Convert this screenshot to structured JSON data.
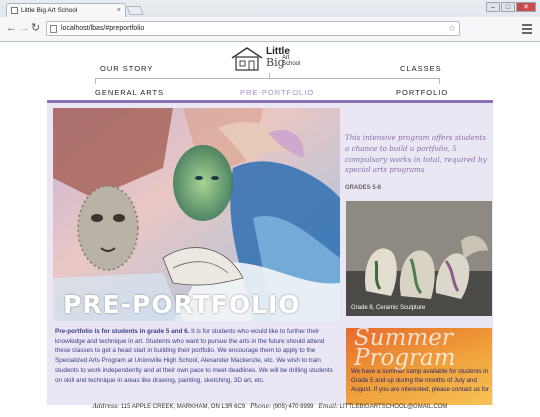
{
  "browser": {
    "tab_title": "Little Big Art School",
    "tab_close": "×",
    "url": "localhost/lbas/#preportfolio",
    "controls": {
      "minimize": "–",
      "maximize": "□",
      "close": "✕"
    },
    "back": "←",
    "forward": "→",
    "reload": "↻"
  },
  "logo": {
    "line1": "Little",
    "line2": "Big",
    "line3a": "Art",
    "line3b": "School"
  },
  "nav": {
    "our_story": "OUR STORY",
    "classes": "CLASSES",
    "general_arts": "GENERAL ARTS",
    "pre_portfolio": "PRE-PORTFOLIO",
    "portfolio": "PORTFOLIO"
  },
  "hero_title": "PRE-PORTFOLIO",
  "intro": "This intensive program offers students a chance to build a portfolio, 5 compulsory works in total, required by special arts programs",
  "grades": "GRADES 5-8",
  "sculpture_caption": "Grade 8, Ceramic Sculpture",
  "description_lead": "Pre-portfolio is for students in grade 5 and 6.",
  "description_body": " It is for students who would like to further their knowledge and technique in art. Students who want to pursue the arts in the future should attend these classes to get a head start in building their portfolio. We encourage them to apply to the Specialized Arts Program at Unionville High School, Alexander Mackenzie, etc. We wish to train students to work independently and at their own pace to meet deadlines. We will be drilling students on skill and technique in areas like drawing, painting, sketching, 3D art, etc.",
  "summer": {
    "title": "Summer Program",
    "text": "We have a summer camp available for students in Grade 5 and up during the months of July and August. If you are interested, please contact us for"
  },
  "footer": {
    "address_label": "Address:",
    "address": "115 APPLE CREEK, MARKHAM, ON L3R 6C9",
    "phone_label": "Phone:",
    "phone": "(905) 470 8999",
    "email_label": "Email:",
    "email": "LITTLEBIGARTSCHOOL@GMAIL.COM"
  },
  "colors": {
    "accent": "#8b72b4",
    "panel": "#ebe6f3",
    "active_nav": "#a58dc6",
    "body_text": "#3a3f8a"
  }
}
